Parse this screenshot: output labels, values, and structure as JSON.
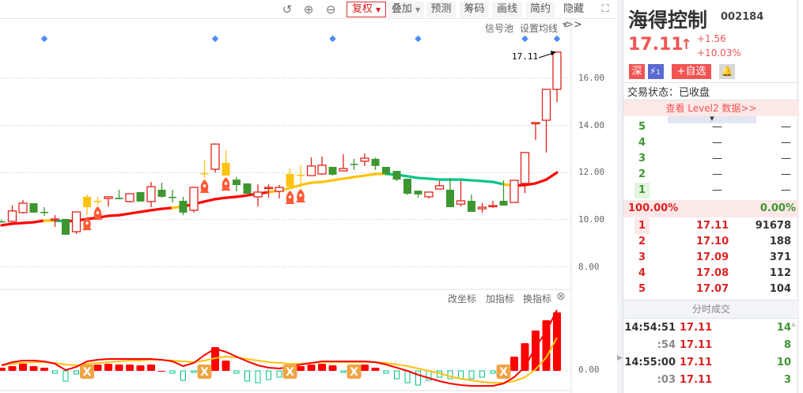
{
  "toolbar": {
    "fuquan": "复权",
    "diejia": "叠加",
    "yuce": "预测",
    "chouma": "筹码",
    "huaxian": "画线",
    "jianyue": "简约",
    "hide": "隐藏>>"
  },
  "chart_links": {
    "signal_pool": "信号池",
    "set_ma": "设置均线"
  },
  "lower_links": {
    "change_axis": "改坐标",
    "add_indicator": "加指标",
    "swap_indicator": "换指标"
  },
  "last_price_label": "17.11",
  "y_axis": [
    "16.00",
    "14.00",
    "12.00",
    "10.00",
    "8.00"
  ],
  "lower_axis": [
    "0.00"
  ],
  "stock": {
    "name": "海得控制",
    "code": "002184",
    "price": "17.11",
    "change": "+1.56",
    "change_pct": "+10.03%",
    "market_badge": "深",
    "level_badge": "1",
    "watch_label": "+自选",
    "status": "交易状态：已收盘",
    "level2": "查看 Level2 数据>>"
  },
  "sell": [
    {
      "n": "5",
      "p": "—",
      "v": "—"
    },
    {
      "n": "4",
      "p": "—",
      "v": "—"
    },
    {
      "n": "3",
      "p": "—",
      "v": "—"
    },
    {
      "n": "2",
      "p": "—",
      "v": "—"
    },
    {
      "n": "1",
      "p": "—",
      "v": "—"
    }
  ],
  "ratio": {
    "buy": "100.00%",
    "sell": "0.00%"
  },
  "buy": [
    {
      "n": "1",
      "p": "17.11",
      "v": "91678"
    },
    {
      "n": "2",
      "p": "17.10",
      "v": "188"
    },
    {
      "n": "3",
      "p": "17.09",
      "v": "371"
    },
    {
      "n": "4",
      "p": "17.08",
      "v": "112"
    },
    {
      "n": "5",
      "p": "17.07",
      "v": "104"
    }
  ],
  "ticks_title": "分时成交",
  "ticks": [
    {
      "t": "14:54:51",
      "p": "17.11",
      "v": "14"
    },
    {
      "t": ":54",
      "p": "17.11",
      "v": "8"
    },
    {
      "t": "14:55:00",
      "p": "17.11",
      "v": "10"
    },
    {
      "t": ":03",
      "p": "17.11",
      "v": "3"
    }
  ],
  "colors": {
    "up": "#e2231a",
    "down": "#3d9630",
    "special": "#ffc20e",
    "ma_flat": "#ffc20e",
    "ma_down": "#00c487",
    "accent": "#ff5b5b"
  },
  "chart_data": {
    "type": "candlestick",
    "ylim": [
      7.1,
      17.8
    ],
    "candles": [
      [
        9.93,
        9.93,
        10.0,
        9.88,
        "g"
      ],
      [
        9.93,
        10.37,
        10.6,
        9.93,
        "r"
      ],
      [
        10.3,
        10.7,
        10.83,
        10.26,
        "r"
      ],
      [
        10.7,
        10.3,
        10.7,
        10.3,
        "g"
      ],
      [
        10.33,
        10.33,
        10.53,
        10.16,
        "g"
      ],
      [
        10.03,
        10.03,
        10.19,
        9.69,
        "r"
      ],
      [
        10.03,
        9.36,
        10.03,
        9.36,
        "g"
      ],
      [
        9.49,
        10.33,
        10.33,
        9.39,
        "r"
      ],
      [
        10.53,
        10.97,
        11.07,
        10.19,
        "y"
      ],
      [
        10.8,
        10.8,
        10.97,
        10.63,
        "y"
      ],
      [
        10.9,
        10.97,
        11.0,
        10.56,
        "r"
      ],
      [
        10.93,
        10.87,
        11.27,
        10.87,
        "g"
      ],
      [
        10.77,
        11.1,
        11.1,
        10.73,
        "r"
      ],
      [
        11.17,
        10.77,
        11.17,
        10.77,
        "g"
      ],
      [
        10.77,
        11.4,
        11.6,
        10.53,
        "r"
      ],
      [
        11.27,
        10.97,
        11.57,
        10.93,
        "g"
      ],
      [
        10.97,
        10.97,
        11.27,
        10.73,
        "g"
      ],
      [
        10.8,
        10.3,
        10.97,
        10.19,
        "g"
      ],
      [
        10.4,
        11.37,
        11.37,
        10.3,
        "r"
      ],
      [
        11.97,
        11.97,
        12.51,
        11.77,
        "y"
      ],
      [
        12.14,
        13.21,
        13.21,
        12.0,
        "r"
      ],
      [
        12.41,
        11.87,
        12.95,
        11.87,
        "y"
      ],
      [
        11.7,
        11.47,
        11.81,
        11.2,
        "g"
      ],
      [
        11.54,
        11.1,
        11.54,
        11.1,
        "g"
      ],
      [
        10.97,
        11.17,
        11.5,
        10.56,
        "r"
      ],
      [
        11.37,
        11.37,
        11.5,
        10.93,
        "r"
      ],
      [
        11.2,
        11.37,
        11.47,
        10.9,
        "r"
      ],
      [
        11.94,
        11.4,
        12.17,
        11.3,
        "y"
      ],
      [
        11.91,
        11.91,
        12.31,
        11.37,
        "y"
      ],
      [
        11.87,
        12.28,
        12.64,
        11.87,
        "r"
      ],
      [
        11.94,
        12.31,
        12.68,
        11.9,
        "r"
      ],
      [
        12.24,
        11.91,
        12.24,
        11.87,
        "g"
      ],
      [
        12.07,
        12.17,
        12.78,
        12.07,
        "r"
      ],
      [
        12.37,
        12.37,
        12.58,
        12.11,
        "g"
      ],
      [
        12.48,
        12.61,
        12.81,
        12.28,
        "r"
      ],
      [
        12.58,
        12.28,
        12.64,
        12.11,
        "g"
      ],
      [
        12.24,
        11.94,
        12.24,
        11.9,
        "g"
      ],
      [
        12.07,
        11.7,
        12.07,
        11.64,
        "g"
      ],
      [
        11.74,
        11.1,
        11.74,
        11.05,
        "g"
      ],
      [
        11.23,
        11.07,
        11.23,
        10.93,
        "g"
      ],
      [
        10.97,
        11.17,
        11.17,
        10.9,
        "r"
      ],
      [
        11.3,
        11.44,
        11.64,
        11.3,
        "r"
      ],
      [
        11.27,
        10.53,
        11.77,
        10.53,
        "g"
      ],
      [
        10.66,
        10.8,
        11.64,
        10.56,
        "r"
      ],
      [
        10.8,
        10.33,
        11.07,
        10.33,
        "g"
      ],
      [
        10.46,
        10.53,
        10.7,
        10.3,
        "r"
      ],
      [
        10.6,
        10.6,
        10.8,
        10.5,
        "r"
      ],
      [
        10.8,
        10.6,
        11.67,
        10.6,
        "g"
      ],
      [
        10.73,
        11.67,
        11.67,
        10.73,
        "r"
      ],
      [
        11.54,
        12.85,
        12.85,
        11.13,
        "r"
      ],
      [
        14.12,
        14.12,
        14.12,
        13.38,
        "r"
      ],
      [
        14.22,
        15.53,
        15.53,
        12.85,
        "r"
      ],
      [
        15.53,
        17.11,
        17.11,
        14.99,
        "r"
      ]
    ],
    "ma": [
      9.76,
      9.83,
      9.86,
      9.89,
      9.96,
      9.96,
      9.93,
      9.96,
      10.03,
      10.09,
      10.16,
      10.19,
      10.26,
      10.33,
      10.4,
      10.46,
      10.5,
      10.56,
      10.66,
      10.77,
      10.87,
      10.93,
      10.97,
      11.03,
      11.1,
      11.17,
      11.23,
      11.34,
      11.47,
      11.57,
      11.6,
      11.67,
      11.74,
      11.81,
      11.87,
      11.94,
      11.94,
      11.91,
      11.84,
      11.77,
      11.74,
      11.7,
      11.7,
      11.7,
      11.67,
      11.64,
      11.6,
      11.5,
      11.44,
      11.47,
      11.54,
      11.7,
      12.0
    ],
    "ma_trend": "rrrryg rrrrrrrrrryrrrrrrrryyyyyyyyyyygggggggggggyrrrrr",
    "rockets": [
      9,
      10,
      20,
      22,
      28,
      29
    ],
    "signals": [
      5,
      21,
      32,
      40,
      50,
      53
    ],
    "macd": {
      "ylim": [
        -30,
        100
      ],
      "bars": [
        4,
        6,
        9,
        6,
        4,
        -3,
        -13,
        -4,
        3,
        8,
        9,
        8,
        8,
        7,
        8,
        0,
        -3,
        -12,
        -2,
        6,
        30,
        13,
        -3,
        -13,
        -15,
        -11,
        -8,
        -4,
        6,
        8,
        9,
        7,
        -2,
        2,
        8,
        4,
        -3,
        -10,
        -15,
        -18,
        -12,
        -8,
        -10,
        -10,
        -10,
        -8,
        -3,
        3,
        18,
        35,
        51,
        64,
        74
      ],
      "dif": [
        7,
        11,
        13,
        13,
        12,
        9,
        1,
        5,
        12,
        14,
        15,
        15,
        15,
        15,
        15,
        14,
        12,
        6,
        10,
        20,
        28,
        24,
        18,
        12,
        7,
        4,
        3,
        5,
        8,
        10,
        12,
        12,
        12,
        12,
        12,
        11,
        8,
        4,
        0,
        -5,
        -9,
        -13,
        -16,
        -18,
        -19,
        -19,
        -19,
        -16,
        -8,
        5,
        30,
        50,
        77
      ],
      "dea": [
        7,
        9,
        10,
        11,
        11,
        10,
        8,
        7,
        9,
        10,
        11,
        12,
        13,
        13,
        14,
        14,
        13,
        12,
        11,
        13,
        16,
        18,
        17,
        15,
        13,
        11,
        10,
        9,
        9,
        10,
        11,
        11,
        11,
        11,
        11,
        11,
        10,
        8,
        6,
        3,
        0,
        -3,
        -7,
        -10,
        -12,
        -14,
        -15,
        -15,
        -13,
        -8,
        2,
        17,
        42
      ],
      "cross": [
        9,
        20,
        28,
        34,
        48
      ]
    }
  }
}
